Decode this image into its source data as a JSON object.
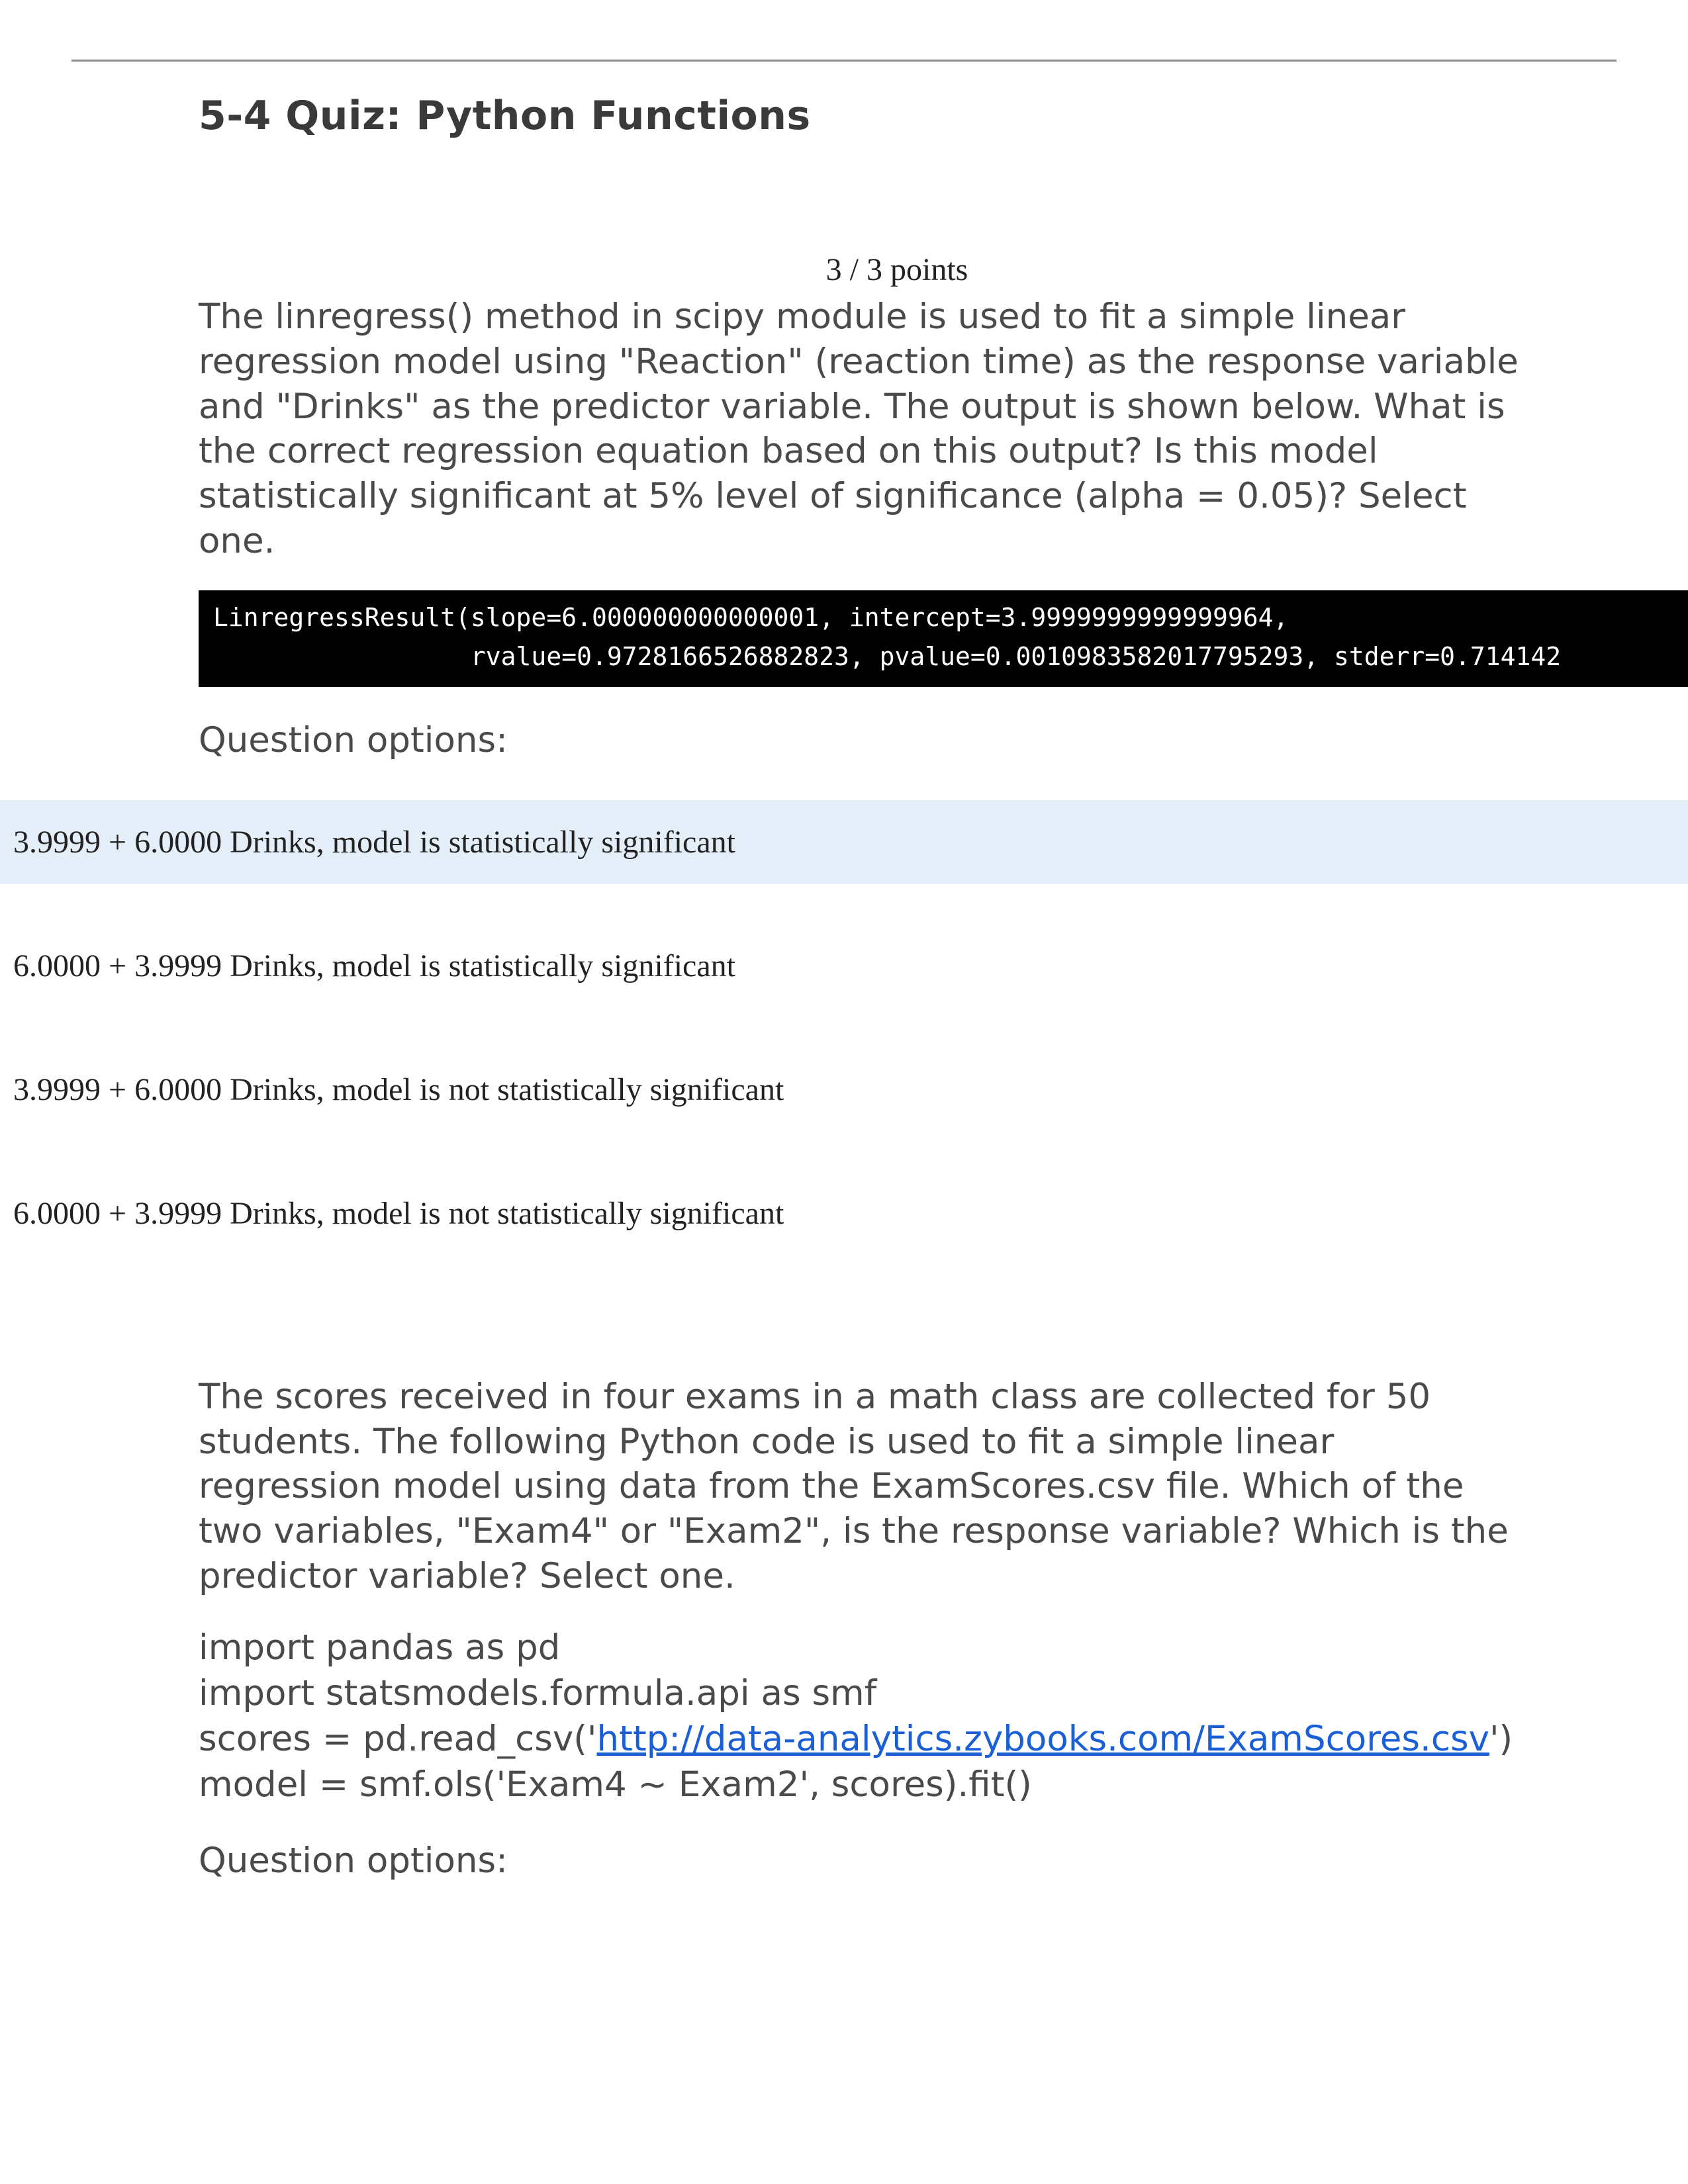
{
  "header": {
    "title": "5-4 Quiz: Python Functions"
  },
  "q1": {
    "points": "3 / 3 points",
    "prompt": "The linregress() method in scipy module is used to fit a simple linear regression model using \"Reaction\" (reaction time) as the response variable and \"Drinks\" as the predictor variable. The output is shown below. What is the correct regression equation based on this output? Is this model statistically significant at 5% level of significance (alpha = 0.05)? Select one.",
    "code_line1": "LinregressResult(slope=6.000000000000001, intercept=3.9999999999999964,",
    "code_line2": "                 rvalue=0.9728166526882823, pvalue=0.0010983582017795293, stderr=0.714142",
    "options_label": "Question options:",
    "options": [
      "3.9999 + 6.0000 Drinks, model is statistically significant",
      "6.0000 + 3.9999 Drinks, model is statistically significant",
      "3.9999 + 6.0000 Drinks, model is not statistically significant",
      "6.0000 + 3.9999 Drinks, model is not statistically significant"
    ]
  },
  "q2": {
    "prompt": "The scores received in four exams in a math class are collected for 50 students. The following Python code is used to fit a simple linear regression model using data from the ExamScores.csv file. Which of the two variables, \"Exam4\" or \"Exam2\", is the response variable? Which is the predictor variable? Select one.",
    "code": {
      "line1": "import pandas as pd",
      "line2": "import statsmodels.formula.api as smf",
      "line3a": "scores = pd.read_csv('",
      "link": "http://data-analytics.zybooks.com/ExamScores.csv",
      "line3b": "')",
      "line4": "model = smf.ols('Exam4 ~ Exam2', scores).fit()"
    },
    "options_label": "Question options:"
  }
}
